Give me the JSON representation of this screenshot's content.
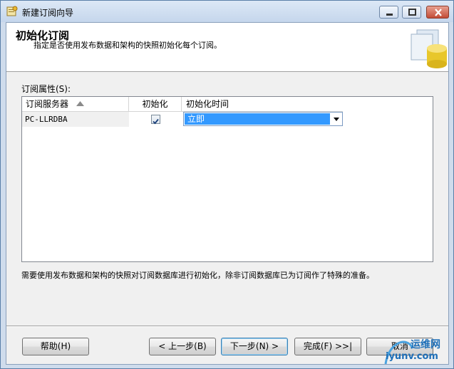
{
  "window": {
    "title": "新建订阅向导"
  },
  "header": {
    "title": "初始化订阅",
    "description": "指定是否使用发布数据和架构的快照初始化每个订阅。"
  },
  "grid": {
    "label": "订阅属性(S):",
    "columns": [
      "订阅服务器",
      "初始化",
      "初始化时间"
    ],
    "rows": [
      {
        "server": "PC-LLRDBA",
        "initialize": true,
        "init_time": "立即"
      }
    ]
  },
  "note": "需要使用发布数据和架构的快照对订阅数据库进行初始化，除非订阅数据库已为订阅作了特殊的准备。",
  "buttons": {
    "help": "帮助(H)",
    "back": "< 上一步(B)",
    "next": "下一步(N) >",
    "finish": "完成(F) >>|",
    "cancel": "取消"
  },
  "watermark": {
    "line1": "运维网",
    "line2": "iyunv.com"
  },
  "colors": {
    "selection": "#3399ff",
    "close_button": "#c34c37"
  }
}
